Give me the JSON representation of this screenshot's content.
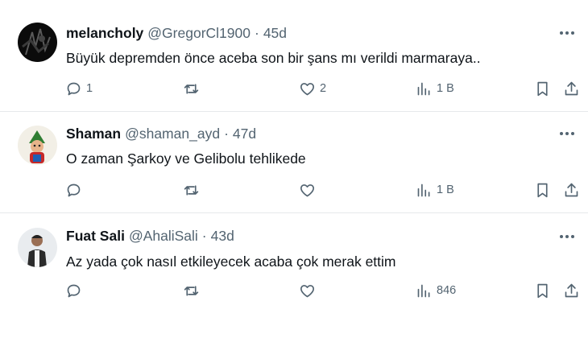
{
  "tweets": [
    {
      "name": "melancholy",
      "handle": "@GregorCl1900",
      "separator": "·",
      "age": "45d",
      "text": "Büyük depremden önce aceba son bir şans mı verildi marmaraya..",
      "replies": "1",
      "reposts": "",
      "likes": "2",
      "views": "1 B"
    },
    {
      "name": "Shaman",
      "handle": "@shaman_ayd",
      "separator": "·",
      "age": "47d",
      "text": "O zaman Şarkoy ve Gelibolu tehlikede",
      "replies": "",
      "reposts": "",
      "likes": "",
      "views": "1 B"
    },
    {
      "name": "Fuat Sali",
      "handle": "@AhaliSali",
      "separator": "·",
      "age": "43d",
      "text": "Az yada çok nasıl etkileyecek acaba çok merak ettim",
      "replies": "",
      "reposts": "",
      "likes": "",
      "views": "846"
    }
  ],
  "icons": {
    "more": "more-horizontal-icon",
    "reply": "reply-bubble-icon",
    "repost": "repost-arrows-icon",
    "like": "heart-icon",
    "views": "views-bar-chart-icon",
    "bookmark": "bookmark-icon",
    "share": "share-upload-icon"
  },
  "colors": {
    "text": "#0f1419",
    "muted": "#536471",
    "divider": "#e6e9eb"
  }
}
